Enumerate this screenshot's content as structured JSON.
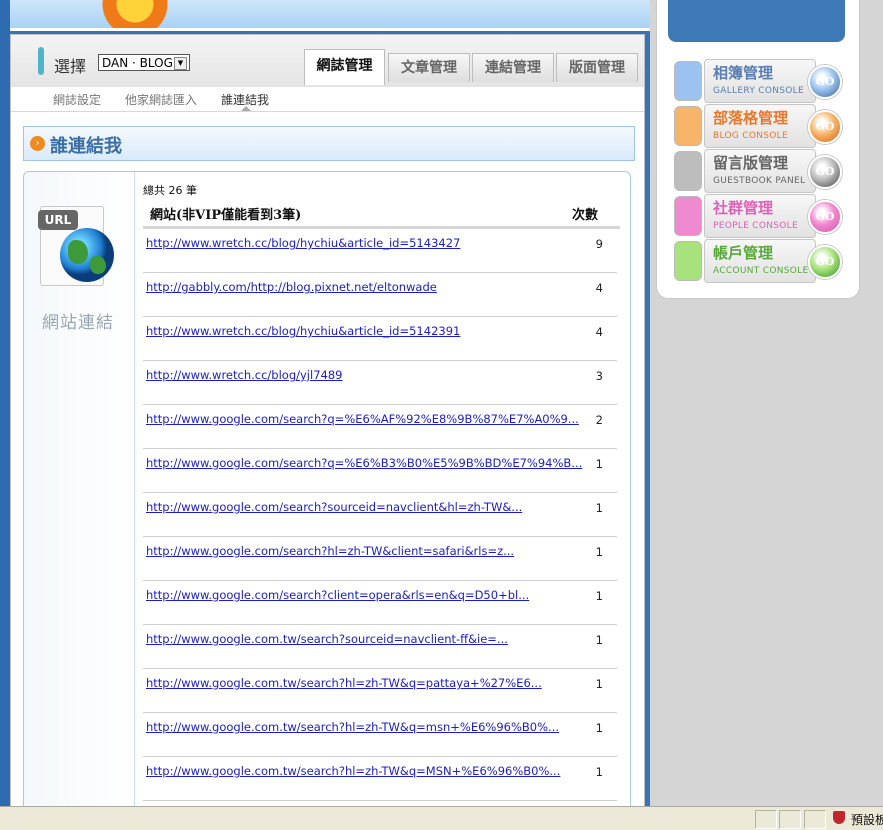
{
  "selector": {
    "label": "選擇",
    "value": "DAN · BLOG"
  },
  "tabs": [
    {
      "label": "網誌管理",
      "active": true
    },
    {
      "label": "文章管理",
      "active": false
    },
    {
      "label": "連結管理",
      "active": false
    },
    {
      "label": "版面管理",
      "active": false
    }
  ],
  "subnav": [
    {
      "label": "網誌設定",
      "active": false
    },
    {
      "label": "他家網誌匯入",
      "active": false
    },
    {
      "label": "誰連結我",
      "active": true
    }
  ],
  "section": {
    "title": "誰連結我"
  },
  "sidebar_card": {
    "icon_tag": "URL",
    "label": "網站連結"
  },
  "table": {
    "total_text": "總共 26 筆",
    "col_site": "網站(非VIP僅能看到3筆)",
    "col_count": "次數",
    "rows": [
      {
        "url": "http://www.wretch.cc/blog/hychiu&article_id=5143427",
        "count": "9"
      },
      {
        "url": "http://gabbly.com/http://blog.pixnet.net/eltonwade",
        "count": "4"
      },
      {
        "url": "http://www.wretch.cc/blog/hychiu&article_id=5142391",
        "count": "4"
      },
      {
        "url": "http://www.wretch.cc/blog/yjl7489",
        "count": "3"
      },
      {
        "url": "http://www.google.com/search?q=%E6%AF%92%E8%9B%87%E7%A0%9...",
        "count": "2"
      },
      {
        "url": "http://www.google.com/search?q=%E6%B3%B0%E5%9B%BD%E7%94%B...",
        "count": "1"
      },
      {
        "url": "http://www.google.com/search?sourceid=navclient&hl=zh-TW&...",
        "count": "1"
      },
      {
        "url": "http://www.google.com/search?hl=zh-TW&client=safari&rls=z...",
        "count": "1"
      },
      {
        "url": "http://www.google.com/search?client=opera&rls=en&q=D50+bl...",
        "count": "1"
      },
      {
        "url": "http://www.google.com.tw/search?sourceid=navclient-ff&ie=...",
        "count": "1"
      },
      {
        "url": "http://www.google.com.tw/search?hl=zh-TW&q=pattaya+%27%E6...",
        "count": "1"
      },
      {
        "url": "http://www.google.com.tw/search?hl=zh-TW&q=msn+%E6%96%B0%...",
        "count": "1"
      },
      {
        "url": "http://www.google.com.tw/search?hl=zh-TW&q=MSN+%E6%96%B0%...",
        "count": "1"
      }
    ]
  },
  "consoles": [
    {
      "title": "相簿管理",
      "subtitle": "GALLERY CONSOLE",
      "color": "#5a7fb0",
      "swatch": "#9cc3f0",
      "go": "GO"
    },
    {
      "title": "部落格管理",
      "subtitle": "BLOG CONSOLE",
      "color": "#e8782c",
      "swatch": "#f7b56a",
      "go": "GO"
    },
    {
      "title": "留言版管理",
      "subtitle": "GUESTBOOK PANEL",
      "color": "#666666",
      "swatch": "#bdbdbd",
      "go": "GO"
    },
    {
      "title": "社群管理",
      "subtitle": "PEOPLE CONSOLE",
      "color": "#e060b8",
      "swatch": "#f08ad0",
      "go": "GO"
    },
    {
      "title": "帳戶管理",
      "subtitle": "ACCOUNT CONSOLE",
      "color": "#58a83a",
      "swatch": "#a8e27c",
      "go": "GO"
    }
  ],
  "statusbar": {
    "zone_text": "預設板"
  }
}
